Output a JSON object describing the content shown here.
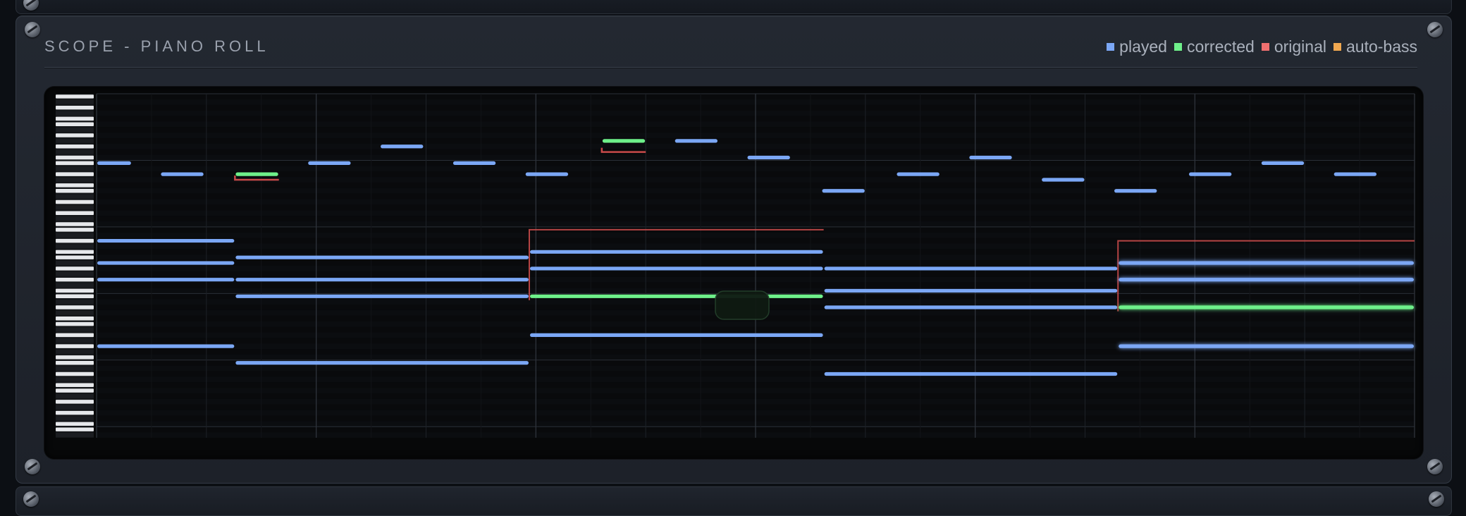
{
  "panel": {
    "title": "SCOPE - PIANO ROLL"
  },
  "legend": [
    {
      "label": "played",
      "color": "#7ba7f5"
    },
    {
      "label": "corrected",
      "color": "#6ef08a"
    },
    {
      "label": "original",
      "color": "#f07070"
    },
    {
      "label": "auto-bass",
      "color": "#f0a850"
    }
  ],
  "colors": {
    "played": "#7ba7f5",
    "corrected": "#6ef08a",
    "original": "#c84a4a",
    "grid": "#1c2026",
    "background": "#070809"
  },
  "roll": {
    "pitch_rows": 62,
    "time_steps": 120,
    "major_beat_every": 20,
    "minor_beat_every": 10,
    "notes": [
      {
        "type": "played",
        "pitch": 12,
        "start": 0,
        "end": 3.2
      },
      {
        "type": "played",
        "pitch": 14,
        "start": 5.8,
        "end": 9.8
      },
      {
        "type": "corrected",
        "pitch": 14,
        "start": 12.6,
        "end": 16.6
      },
      {
        "type": "original",
        "pitch": 15,
        "start": 12.6,
        "end": 16.6
      },
      {
        "type": "played",
        "pitch": 12,
        "start": 19.2,
        "end": 23.2
      },
      {
        "type": "played",
        "pitch": 9,
        "start": 25.8,
        "end": 29.8
      },
      {
        "type": "played",
        "pitch": 12,
        "start": 32.4,
        "end": 36.4
      },
      {
        "type": "played",
        "pitch": 14,
        "start": 39.0,
        "end": 43.0
      },
      {
        "type": "corrected",
        "pitch": 8,
        "start": 46.0,
        "end": 50.0
      },
      {
        "type": "original",
        "pitch": 10,
        "start": 46.0,
        "end": 50.0
      },
      {
        "type": "played",
        "pitch": 8,
        "start": 52.6,
        "end": 56.6
      },
      {
        "type": "played",
        "pitch": 11,
        "start": 59.2,
        "end": 63.2
      },
      {
        "type": "played",
        "pitch": 17,
        "start": 66.0,
        "end": 70.0
      },
      {
        "type": "played",
        "pitch": 14,
        "start": 72.8,
        "end": 76.8
      },
      {
        "type": "played",
        "pitch": 11,
        "start": 79.4,
        "end": 83.4
      },
      {
        "type": "played",
        "pitch": 15,
        "start": 86.0,
        "end": 90.0
      },
      {
        "type": "played",
        "pitch": 17,
        "start": 92.6,
        "end": 96.6
      },
      {
        "type": "played",
        "pitch": 14,
        "start": 99.4,
        "end": 103.4
      },
      {
        "type": "played",
        "pitch": 12,
        "start": 106.0,
        "end": 110.0
      },
      {
        "type": "played",
        "pitch": 14,
        "start": 112.6,
        "end": 116.6
      },
      {
        "type": "played",
        "pitch": 26,
        "start": 0,
        "end": 12.6
      },
      {
        "type": "played",
        "pitch": 30,
        "start": 0,
        "end": 12.6
      },
      {
        "type": "played",
        "pitch": 33,
        "start": 0,
        "end": 12.6
      },
      {
        "type": "played",
        "pitch": 45,
        "start": 0,
        "end": 12.6
      },
      {
        "type": "played",
        "pitch": 29,
        "start": 12.6,
        "end": 39.4
      },
      {
        "type": "played",
        "pitch": 33,
        "start": 12.6,
        "end": 39.4
      },
      {
        "type": "played",
        "pitch": 36,
        "start": 12.6,
        "end": 39.4
      },
      {
        "type": "played",
        "pitch": 48,
        "start": 12.6,
        "end": 39.4
      },
      {
        "type": "original",
        "pitch": 24,
        "start": 39.4,
        "end": 66.2,
        "frame": true
      },
      {
        "type": "played",
        "pitch": 28,
        "start": 39.4,
        "end": 66.2
      },
      {
        "type": "played",
        "pitch": 31,
        "start": 39.4,
        "end": 66.2
      },
      {
        "type": "corrected",
        "pitch": 36,
        "start": 39.4,
        "end": 66.2
      },
      {
        "type": "played",
        "pitch": 43,
        "start": 39.4,
        "end": 66.2
      },
      {
        "type": "played",
        "pitch": 31,
        "start": 66.2,
        "end": 93.0
      },
      {
        "type": "played",
        "pitch": 35,
        "start": 66.2,
        "end": 93.0
      },
      {
        "type": "played",
        "pitch": 38,
        "start": 66.2,
        "end": 93.0
      },
      {
        "type": "played",
        "pitch": 50,
        "start": 66.2,
        "end": 93.0
      },
      {
        "type": "original",
        "pitch": 26,
        "start": 93.0,
        "end": 120,
        "frame": true
      },
      {
        "type": "played",
        "pitch": 30,
        "start": 93.0,
        "end": 120,
        "glow": true
      },
      {
        "type": "played",
        "pitch": 33,
        "start": 93.0,
        "end": 120,
        "glow": true
      },
      {
        "type": "corrected",
        "pitch": 38,
        "start": 93.0,
        "end": 120,
        "glow": true
      },
      {
        "type": "played",
        "pitch": 45,
        "start": 93.0,
        "end": 120,
        "glow": true
      }
    ]
  }
}
